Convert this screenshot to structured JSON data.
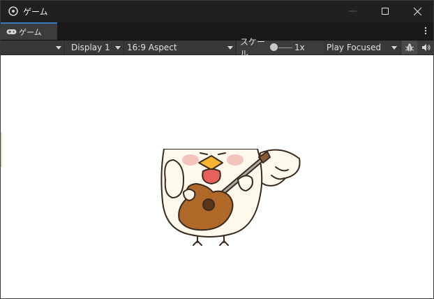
{
  "window": {
    "title": "ゲーム"
  },
  "tab": {
    "label": "ゲーム"
  },
  "toolbar": {
    "display": "Display 1",
    "aspect": "16:9 Aspect",
    "scale_label": "スケール",
    "scale_value": "1x",
    "play_mode": "Play Focused"
  },
  "icons": {
    "app": "unity-icon",
    "tab": "gamepad-icon",
    "minimize": "minimize-icon",
    "maximize": "maximize-icon",
    "close": "close-icon",
    "menu": "kebab-menu-icon",
    "bug": "bug-icon",
    "audio": "speaker-icon"
  },
  "colors": {
    "accent_tab": "#3a79bb",
    "viewport_bg": "#ffffff",
    "toolbar_bg": "#3c3c3c"
  },
  "scene": {
    "subject": "chicken-playing-guitar"
  }
}
